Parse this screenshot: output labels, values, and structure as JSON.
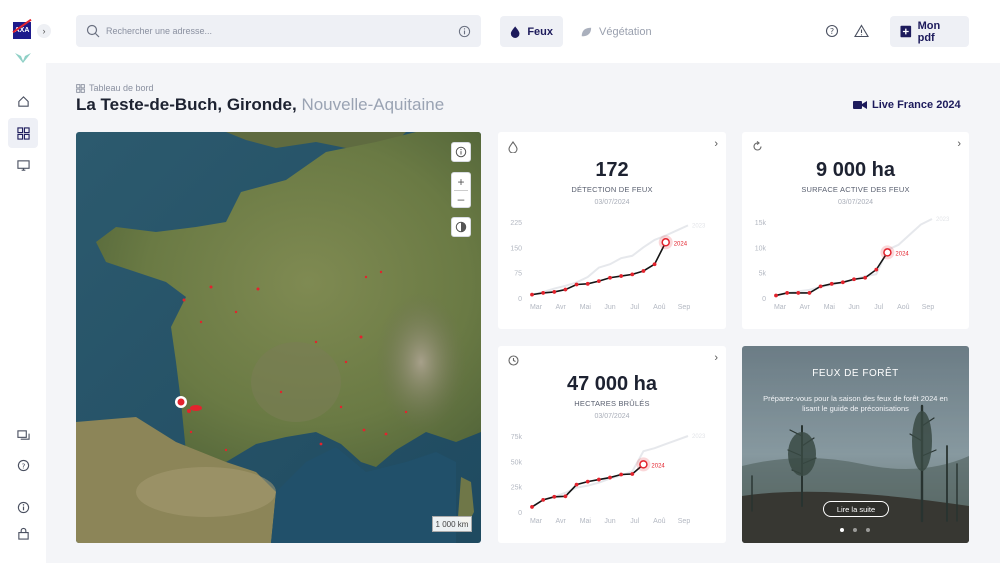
{
  "search": {
    "placeholder": "Rechercher une adresse..."
  },
  "tabs": [
    {
      "label": "Feux",
      "active": true
    },
    {
      "label": "Végétation",
      "active": false
    }
  ],
  "header": {
    "pdf_label": "Mon pdf"
  },
  "breadcrumb": "Tableau de bord",
  "location": {
    "main": "La Teste-de-Buch, Gironde,",
    "region": "Nouvelle-Aquitaine"
  },
  "live_label": "Live France 2024",
  "map": {
    "scale_label": "1 000 km"
  },
  "colors": {
    "navy": "#1d1b8c",
    "fire_red": "#e3232d",
    "panel_bg": "#f4f5f8"
  },
  "cards": [
    {
      "value": "172",
      "label": "DÉTECTION DE FEUX",
      "date": "03/07/2024",
      "icon": "drop-icon",
      "chart_data": {
        "type": "line",
        "categories": [
          "Mar",
          "Avr",
          "Mai",
          "Jun",
          "Jul",
          "Aoû",
          "Sep"
        ],
        "y_ticks": [
          "225",
          "150",
          "75",
          "0"
        ],
        "ylim": [
          0,
          225
        ],
        "series": [
          {
            "name": "2024",
            "values": [
              10,
              15,
              18,
              25,
              40,
              42,
              50,
              60,
              65,
              70,
              80,
              100,
              165
            ]
          },
          {
            "name": "2023",
            "values": [
              10,
              18,
              28,
              36,
              46,
              62,
              90,
              100,
              118,
              125,
              150,
              172,
              185,
              200,
              215
            ]
          }
        ]
      }
    },
    {
      "value": "9 000 ha",
      "label": "SURFACE ACTIVE DES FEUX",
      "date": "03/07/2024",
      "icon": "refresh-icon",
      "chart_data": {
        "type": "line",
        "categories": [
          "Mar",
          "Avr",
          "Mai",
          "Jun",
          "Jul",
          "Aoû",
          "Sep"
        ],
        "y_ticks": [
          "15k",
          "10k",
          "5k",
          "0"
        ],
        "ylim": [
          0,
          15000
        ],
        "series": [
          {
            "name": "2024",
            "values": [
              500,
              1000,
              1000,
              1000,
              2300,
              2800,
              3100,
              3700,
              4000,
              5600,
              9000
            ]
          },
          {
            "name": "2023",
            "values": [
              500,
              1000,
              1300,
              1600,
              2200,
              2600,
              3100,
              3600,
              4300,
              4700,
              9500,
              10500,
              12500,
              14500,
              15600
            ]
          }
        ]
      }
    },
    {
      "value": "47 000 ha",
      "label": "HECTARES BRÛLÉS",
      "date": "03/07/2024",
      "icon": "timer-icon",
      "chart_data": {
        "type": "line",
        "categories": [
          "Mar",
          "Avr",
          "Mai",
          "Jun",
          "Jul",
          "Aoû",
          "Sep"
        ],
        "y_ticks": [
          "75k",
          "50k",
          "25k",
          "0"
        ],
        "ylim": [
          0,
          75000
        ],
        "series": [
          {
            "name": "2024",
            "values": [
              5000,
              12000,
              15000,
              15500,
              27000,
              30000,
              32000,
              34000,
              37000,
              37500,
              47000
            ]
          },
          {
            "name": "2023",
            "values": [
              5000,
              12000,
              15000,
              19000,
              24000,
              26000,
              29000,
              33000,
              36000,
              40000,
              60000,
              63000,
              67000,
              71000,
              75000
            ]
          }
        ]
      }
    }
  ],
  "promo": {
    "title": "FEUX DE FORÊT",
    "text": "Préparez-vous pour la saison des feux de forêt 2024 en lisant le guide de préconisations",
    "button": "Lire la suite",
    "slides": 3,
    "active_slide": 1
  }
}
